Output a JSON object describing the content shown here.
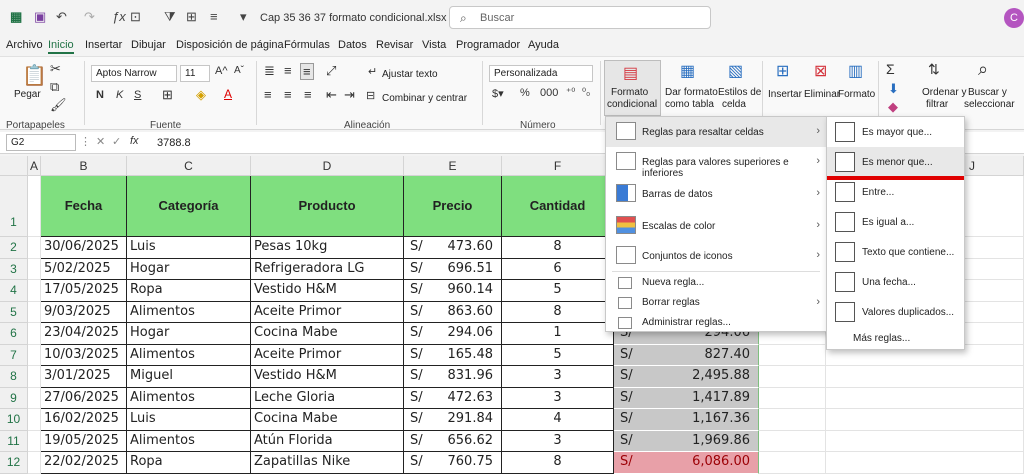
{
  "titlebar": {
    "filename": "Cap 35  36  37 formato condicional.xlsx  -",
    "search_placeholder": "Buscar",
    "avatar": "C"
  },
  "tabs": [
    "Archivo",
    "Inicio",
    "Insertar",
    "Dibujar",
    "Disposición de página",
    "Fórmulas",
    "Datos",
    "Revisar",
    "Vista",
    "Programador",
    "Ayuda"
  ],
  "ribbon": {
    "paste": "Pegar",
    "portapapeles": "Portapapeles",
    "font_name": "Aptos Narrow",
    "font_size": "11",
    "fuente": "Fuente",
    "ajustar": "Ajustar texto",
    "combinar": "Combinar y centrar",
    "alineacion": "Alineación",
    "number_format": "Personalizada",
    "numero": "Número",
    "formato_cond_1": "Formato",
    "formato_cond_2": "condicional",
    "dar_formato_1": "Dar formato",
    "dar_formato_2": "como tabla",
    "estilos_1": "Estilos de",
    "estilos_2": "celda",
    "insertar": "Insertar",
    "eliminar": "Eliminar",
    "formato": "Formato",
    "ordenar_1": "Ordenar y",
    "ordenar_2": "filtrar",
    "buscar_1": "Buscar y",
    "buscar_2": "seleccionar"
  },
  "formula_bar": {
    "name_box": "G2",
    "fx": "fx",
    "value": "3788.8"
  },
  "columns": [
    "A",
    "B",
    "C",
    "D",
    "E",
    "F",
    "J"
  ],
  "rows": [
    "1",
    "2",
    "3",
    "4",
    "5",
    "6",
    "7",
    "8",
    "9",
    "10",
    "11",
    "12"
  ],
  "table": {
    "headers": [
      "Fecha",
      "Categoría",
      "Producto",
      "Precio",
      "Cantidad"
    ],
    "data": [
      [
        "30/06/2025",
        "Luis",
        "Pesas 10kg",
        "S/",
        "473.60",
        "8"
      ],
      [
        "5/02/2025",
        "Hogar",
        "Refrigeradora LG",
        "S/",
        "696.51",
        "6"
      ],
      [
        "17/05/2025",
        "Ropa",
        "Vestido H&M",
        "S/",
        "960.14",
        "5"
      ],
      [
        "9/03/2025",
        "Alimentos",
        "Aceite Primor",
        "S/",
        "863.60",
        "8"
      ],
      [
        "23/04/2025",
        "Hogar",
        "Cocina Mabe",
        "S/",
        "294.06",
        "1"
      ],
      [
        "10/03/2025",
        "Alimentos",
        "Aceite Primor",
        "S/",
        "165.48",
        "5"
      ],
      [
        "3/01/2025",
        "Miguel",
        "Vestido H&M",
        "S/",
        "831.96",
        "3"
      ],
      [
        "27/06/2025",
        "Alimentos",
        "Leche Gloria",
        "S/",
        "472.63",
        "3"
      ],
      [
        "16/02/2025",
        "Luis",
        "Cocina Mabe",
        "S/",
        "291.84",
        "4"
      ],
      [
        "19/05/2025",
        "Alimentos",
        "Atún Florida",
        "S/",
        "656.62",
        "3"
      ],
      [
        "22/02/2025",
        "Ropa",
        "Zapatillas Nike",
        "S/",
        "760.75",
        "8"
      ]
    ],
    "totals": [
      {
        "cur": "S/",
        "val": "294.06"
      },
      {
        "cur": "S/",
        "val": "827.40"
      },
      {
        "cur": "S/",
        "val": "2,495.88"
      },
      {
        "cur": "S/",
        "val": "1,417.89"
      },
      {
        "cur": "S/",
        "val": "1,167.36"
      },
      {
        "cur": "S/",
        "val": "1,969.86"
      },
      {
        "cur": "S/",
        "val": "6,086.00"
      }
    ]
  },
  "dropdown": {
    "items": [
      "Reglas para resaltar celdas",
      "Reglas para valores superiores e inferiores",
      "Barras de datos",
      "Escalas de color",
      "Conjuntos de iconos"
    ],
    "small_items": [
      "Nueva regla...",
      "Borrar reglas",
      "Administrar reglas..."
    ]
  },
  "submenu": {
    "items": [
      "Es mayor que...",
      "Es menor que...",
      "Entre...",
      "Es igual a...",
      "Texto que contiene...",
      "Una fecha...",
      "Valores duplicados..."
    ],
    "more": "Más reglas..."
  },
  "colors": {
    "header_green": "#7fdf7f",
    "highlight_red": "#e8a0a8",
    "gray_fill": "#c8c8c8",
    "red_underline": "#e00000"
  }
}
